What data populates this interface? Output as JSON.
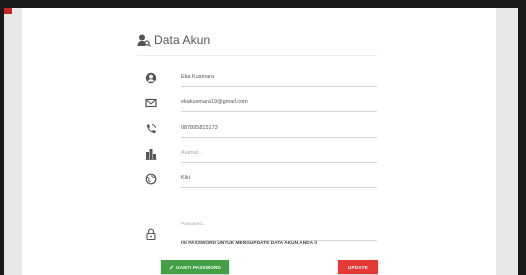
{
  "page": {
    "title": "Data Akun"
  },
  "fields": {
    "name": {
      "value": "Eka Kusmara",
      "icon": "user-circle-icon"
    },
    "email": {
      "value": "ekakusmara19@gmail.com",
      "icon": "envelope-icon"
    },
    "phone": {
      "value": "087895815173",
      "icon": "phone-icon"
    },
    "address": {
      "placeholder": "Alamat...",
      "icon": "building-icon"
    },
    "city": {
      "value": "Kiki",
      "icon": "globe-icon"
    },
    "password": {
      "placeholder": "Password...",
      "icon": "lock-icon"
    }
  },
  "note": "ISI PASSWORD UNTUK MENGUPDATE DATA AKUN ANDA !!",
  "buttons": {
    "change_password": "GANTI PASSWORD",
    "update": "UPDATE"
  },
  "colors": {
    "green_button": "#43a047",
    "red_button": "#e53935",
    "icon": "#555555"
  }
}
